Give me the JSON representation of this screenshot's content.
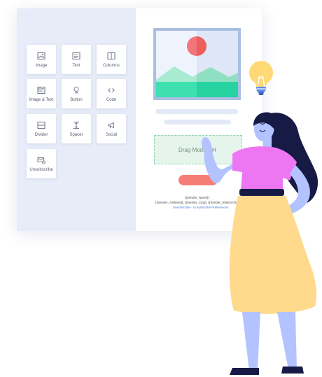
{
  "modules": [
    {
      "label": "Image",
      "icon": "image-icon"
    },
    {
      "label": "Text",
      "icon": "text-icon"
    },
    {
      "label": "Columns",
      "icon": "columns-icon"
    },
    {
      "label": "Image & Text",
      "icon": "image-text-icon"
    },
    {
      "label": "Button",
      "icon": "button-icon"
    },
    {
      "label": "Code",
      "icon": "code-icon"
    },
    {
      "label": "Divider",
      "icon": "divider-icon"
    },
    {
      "label": "Spacer",
      "icon": "spacer-icon"
    },
    {
      "label": "Social",
      "icon": "megaphone-icon"
    },
    {
      "label": "Unsubscribe",
      "icon": "unsubscribe-icon"
    }
  ],
  "canvas": {
    "drop_label": "Drag Module H",
    "sender_name": "{{Sender_Name}}",
    "sender_address": "{{Sender_Address}}, {{Sender_City}}, {{Sender_State}} {{Sender_Z",
    "unsubscribe_links": "Unsubscribe - Unsubscribe Preferences"
  },
  "colors": {
    "panel": "#e7ecf8",
    "accent_green": "#27d3a0",
    "accent_red": "#f47e76",
    "link_blue": "#3b7bd8"
  }
}
